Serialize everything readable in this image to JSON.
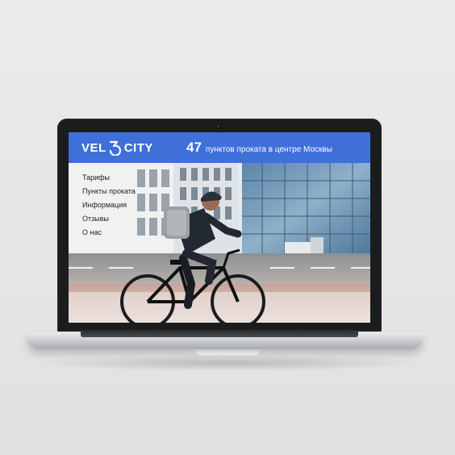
{
  "site": {
    "logo_left": "VEL",
    "logo_right": "CITY",
    "headline_number": "47",
    "headline_text": "пунктов проката в центре Москвы"
  },
  "menu": {
    "items": [
      {
        "label": "Тарифы"
      },
      {
        "label": "Пункты проката"
      },
      {
        "label": "Информация"
      },
      {
        "label": "Отзывы"
      },
      {
        "label": "О нас"
      }
    ]
  },
  "colors": {
    "header_bg": "#3f6fd9",
    "header_text": "#ffffff",
    "laptop_bezel": "#1b1c1e"
  }
}
